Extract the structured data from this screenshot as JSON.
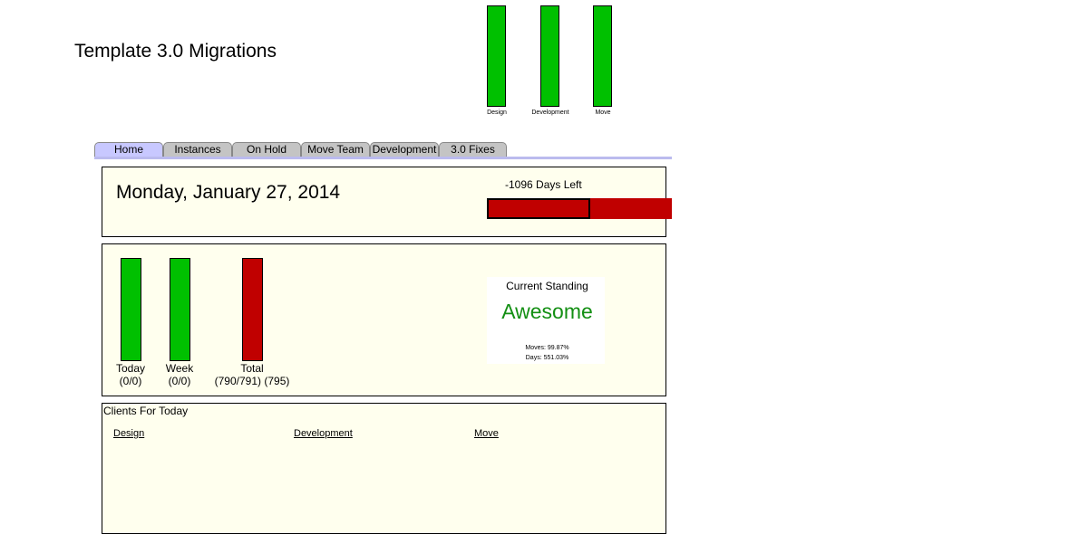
{
  "header": {
    "title": "Template 3.0 Migrations"
  },
  "top_bars": [
    {
      "label": "Design",
      "color": "#00c000"
    },
    {
      "label": "Development",
      "color": "#00c000"
    },
    {
      "label": "Move",
      "color": "#00c000"
    }
  ],
  "tabs": [
    {
      "label": "Home",
      "active": true
    },
    {
      "label": "Instances",
      "active": false
    },
    {
      "label": "On Hold",
      "active": false
    },
    {
      "label": "Move Team",
      "active": false
    },
    {
      "label": "Development",
      "active": false
    },
    {
      "label": "3.0 Fixes",
      "active": false
    }
  ],
  "date_panel": {
    "date": "Monday, January 27, 2014",
    "days_left": "-1096 Days Left",
    "bar_color": "#c00000"
  },
  "stats": [
    {
      "label": "Today",
      "value": "(0/0)",
      "color": "#00c000"
    },
    {
      "label": "Week",
      "value": "(0/0)",
      "color": "#00c000"
    },
    {
      "label": "Total",
      "value": "(790/791) (795)",
      "color": "#c00000"
    }
  ],
  "standing": {
    "title": "Current Standing",
    "value": "Awesome",
    "moves": "Moves: 99.87%",
    "days": "Days: 551.03%",
    "value_color": "#138f13"
  },
  "clients": {
    "title": "Clients For Today",
    "columns": [
      "Design",
      "Development",
      "Move"
    ]
  }
}
